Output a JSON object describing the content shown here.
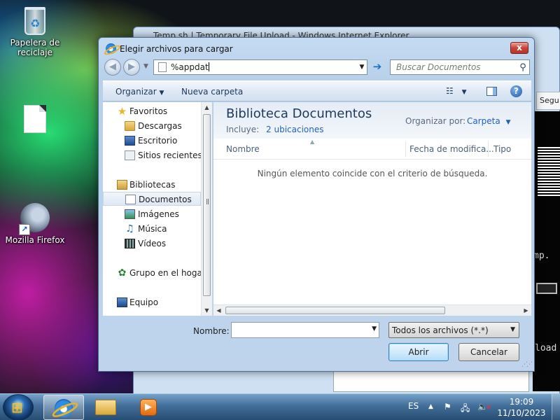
{
  "desktop": {
    "icons": [
      {
        "label": "Papelera de reciclaje"
      },
      {
        "label": ""
      },
      {
        "label": "Mozilla Firefox"
      }
    ]
  },
  "background_window": {
    "title": "Temp.sh | Temporary File Upload - Windows Internet Explorer",
    "tab_partial": "Segu",
    "text_1": "mp.",
    "text_2": "load"
  },
  "dialog": {
    "title": "Elegir archivos para cargar",
    "close_label": "x",
    "address_value": "%appdat",
    "search_placeholder": "Buscar Documentos",
    "toolbar": {
      "organize": "Organizar",
      "new_folder": "Nueva carpeta"
    },
    "nav": {
      "favorites": "Favoritos",
      "downloads": "Descargas",
      "desktop": "Escritorio",
      "recent": "Sitios recientes",
      "libraries": "Bibliotecas",
      "documents": "Documentos",
      "images": "Imágenes",
      "music": "Música",
      "videos": "Vídeos",
      "homegroup": "Grupo en el hogar",
      "computer": "Equipo"
    },
    "library": {
      "title": "Biblioteca Documentos",
      "includes_label": "Incluye:",
      "includes_link": "2 ubicaciones",
      "arrange_label": "Organizar por:",
      "arrange_value": "Carpeta"
    },
    "columns": {
      "name": "Nombre",
      "date": "Fecha de modifica...",
      "type": "Tipo"
    },
    "empty_message": "Ningún elemento coincide con el criterio de búsqueda.",
    "file_name_label": "Nombre:",
    "file_name_value": "",
    "filter": "Todos los archivos (*.*)",
    "open_button": "Abrir",
    "cancel_button": "Cancelar"
  },
  "taskbar": {
    "language": "ES",
    "time": "19:09",
    "date": "11/10/2023"
  },
  "colors": {
    "accent_link": "#1f63b8",
    "title_text": "#1e395b",
    "close_red": "#c6453a"
  }
}
